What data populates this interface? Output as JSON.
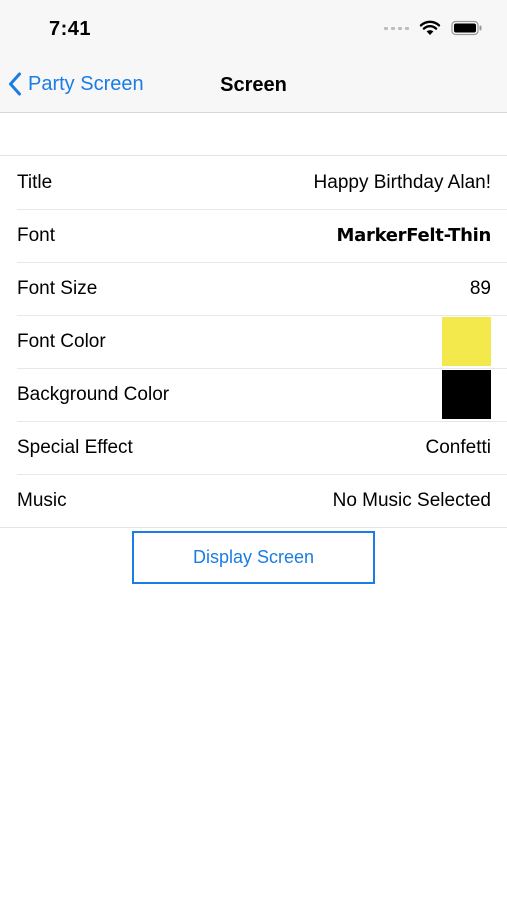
{
  "status_bar": {
    "time": "7:41",
    "icons": [
      "signal-dots-icon",
      "wifi-icon",
      "battery-icon"
    ]
  },
  "nav": {
    "back_label": "Party Screen",
    "title": "Screen"
  },
  "rows": [
    {
      "label": "Title",
      "value": "Happy Birthday Alan!"
    },
    {
      "label": "Font",
      "value": "MarkerFelt-Thin"
    },
    {
      "label": "Font Size",
      "value": "89"
    },
    {
      "label": "Font Color",
      "swatch": "#f3e94d"
    },
    {
      "label": "Background Color",
      "swatch": "#000000"
    },
    {
      "label": "Special Effect",
      "value": "Confetti"
    },
    {
      "label": "Music",
      "value": "No Music Selected"
    }
  ],
  "display_button": {
    "label": "Display Screen"
  },
  "colors": {
    "accent": "#1a7ce5"
  }
}
